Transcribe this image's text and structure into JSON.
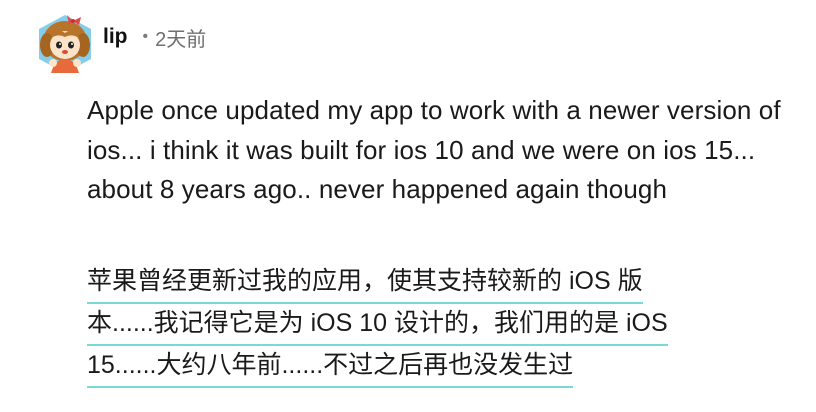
{
  "comment": {
    "author": {
      "username": "lip",
      "avatar_icon": "cartoon-girl-avatar-icon"
    },
    "meta": {
      "separator": "•",
      "timestamp": "2天前"
    },
    "text_en": "Apple once updated my app to work with a newer version of ios... i think it was built for ios 10 and we were on ios 15... about 8 years ago.. never happened again though",
    "translation_zh": {
      "lines": [
        "苹果曾经更新过我的应用，使其支持较新的 iOS 版",
        "本......我记得它是为 iOS 10 设计的，我们用的是 iOS",
        "15......大约八年前......不过之后再也没发生过"
      ],
      "underline_color": "#7ad8d8"
    }
  }
}
